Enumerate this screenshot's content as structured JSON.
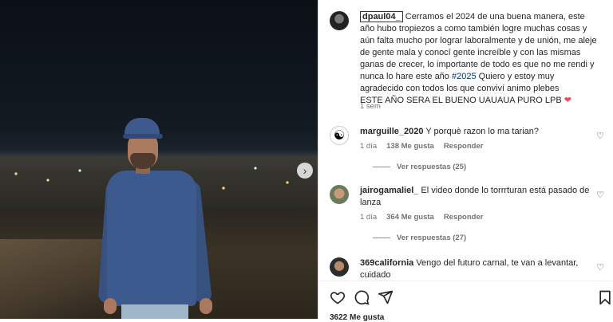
{
  "post": {
    "author": "dpaul04_",
    "caption_main": " Cerramos el 2024 de una buena manera, este año hubo tropiezos a como también logre muchas cosas y aún falta mucho por lograr laboralmente y de unión, me aleje de gente mala y conocí gente increíble y con las mismas ganas de crecer, lo importante de todo es que no me rendi y nunca lo hare este año ",
    "hashtag": "#2025",
    "caption_tail": " Quiero y estoy muy agradecido con todos los que conviví animo plebes",
    "caption_line2": "ESTE AÑO SERA EL BUENO UAUAUA PURO LPB ",
    "heart_emoji": "❤",
    "time": "1 sem"
  },
  "comments": [
    {
      "username": "marguille_2020",
      "text": " Y porquè razon lo ma tarian?",
      "time": "1 día",
      "likes": "138 Me gusta",
      "reply_label": "Responder",
      "view_replies": "Ver respuestas (25)",
      "avatar_glyph": "☯"
    },
    {
      "username": "jairogamaliel_",
      "text": " El video donde lo torrrturan está pasado de lanza",
      "time": "1 día",
      "likes": "364 Me gusta",
      "reply_label": "Responder",
      "view_replies": "Ver respuestas (27)"
    },
    {
      "username": "369california",
      "text": " Vengo del futuro carnal, te van a levantar, cuidado"
    }
  ],
  "footer": {
    "likes_partial": "3622 Me gusta"
  },
  "icons": {
    "like": "heart-outline-icon",
    "comment": "comment-bubble-icon",
    "share": "paper-plane-icon",
    "save": "bookmark-icon",
    "next": "chevron-right-icon"
  },
  "colors": {
    "hashtag": "#00376b",
    "heart": "#ed4956",
    "muted_text": "#737373"
  }
}
